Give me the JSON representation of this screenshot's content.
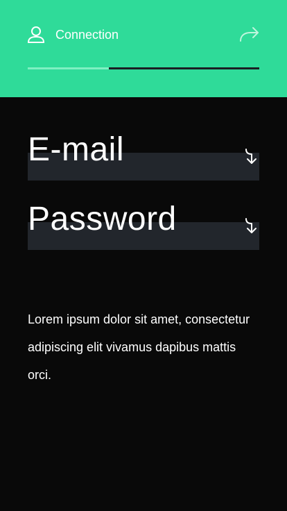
{
  "header": {
    "title": "Connection",
    "user_icon": "user-icon",
    "forward_icon": "forward-arrow-icon",
    "background_color": "#2fdb99",
    "progress": 0.35,
    "progress_fill_color": "#7ff0c2",
    "progress_rest_color": "#1a1f23"
  },
  "form": {
    "email": {
      "label": "E-mail",
      "value": "",
      "arrow_icon": "arrow-down-icon"
    },
    "password": {
      "label": "Password",
      "value": "",
      "arrow_icon": "arrow-down-icon"
    }
  },
  "body_text": "Lorem ipsum dolor sit amet, consectetur adipiscing elit vivamus dapibus mattis orci."
}
